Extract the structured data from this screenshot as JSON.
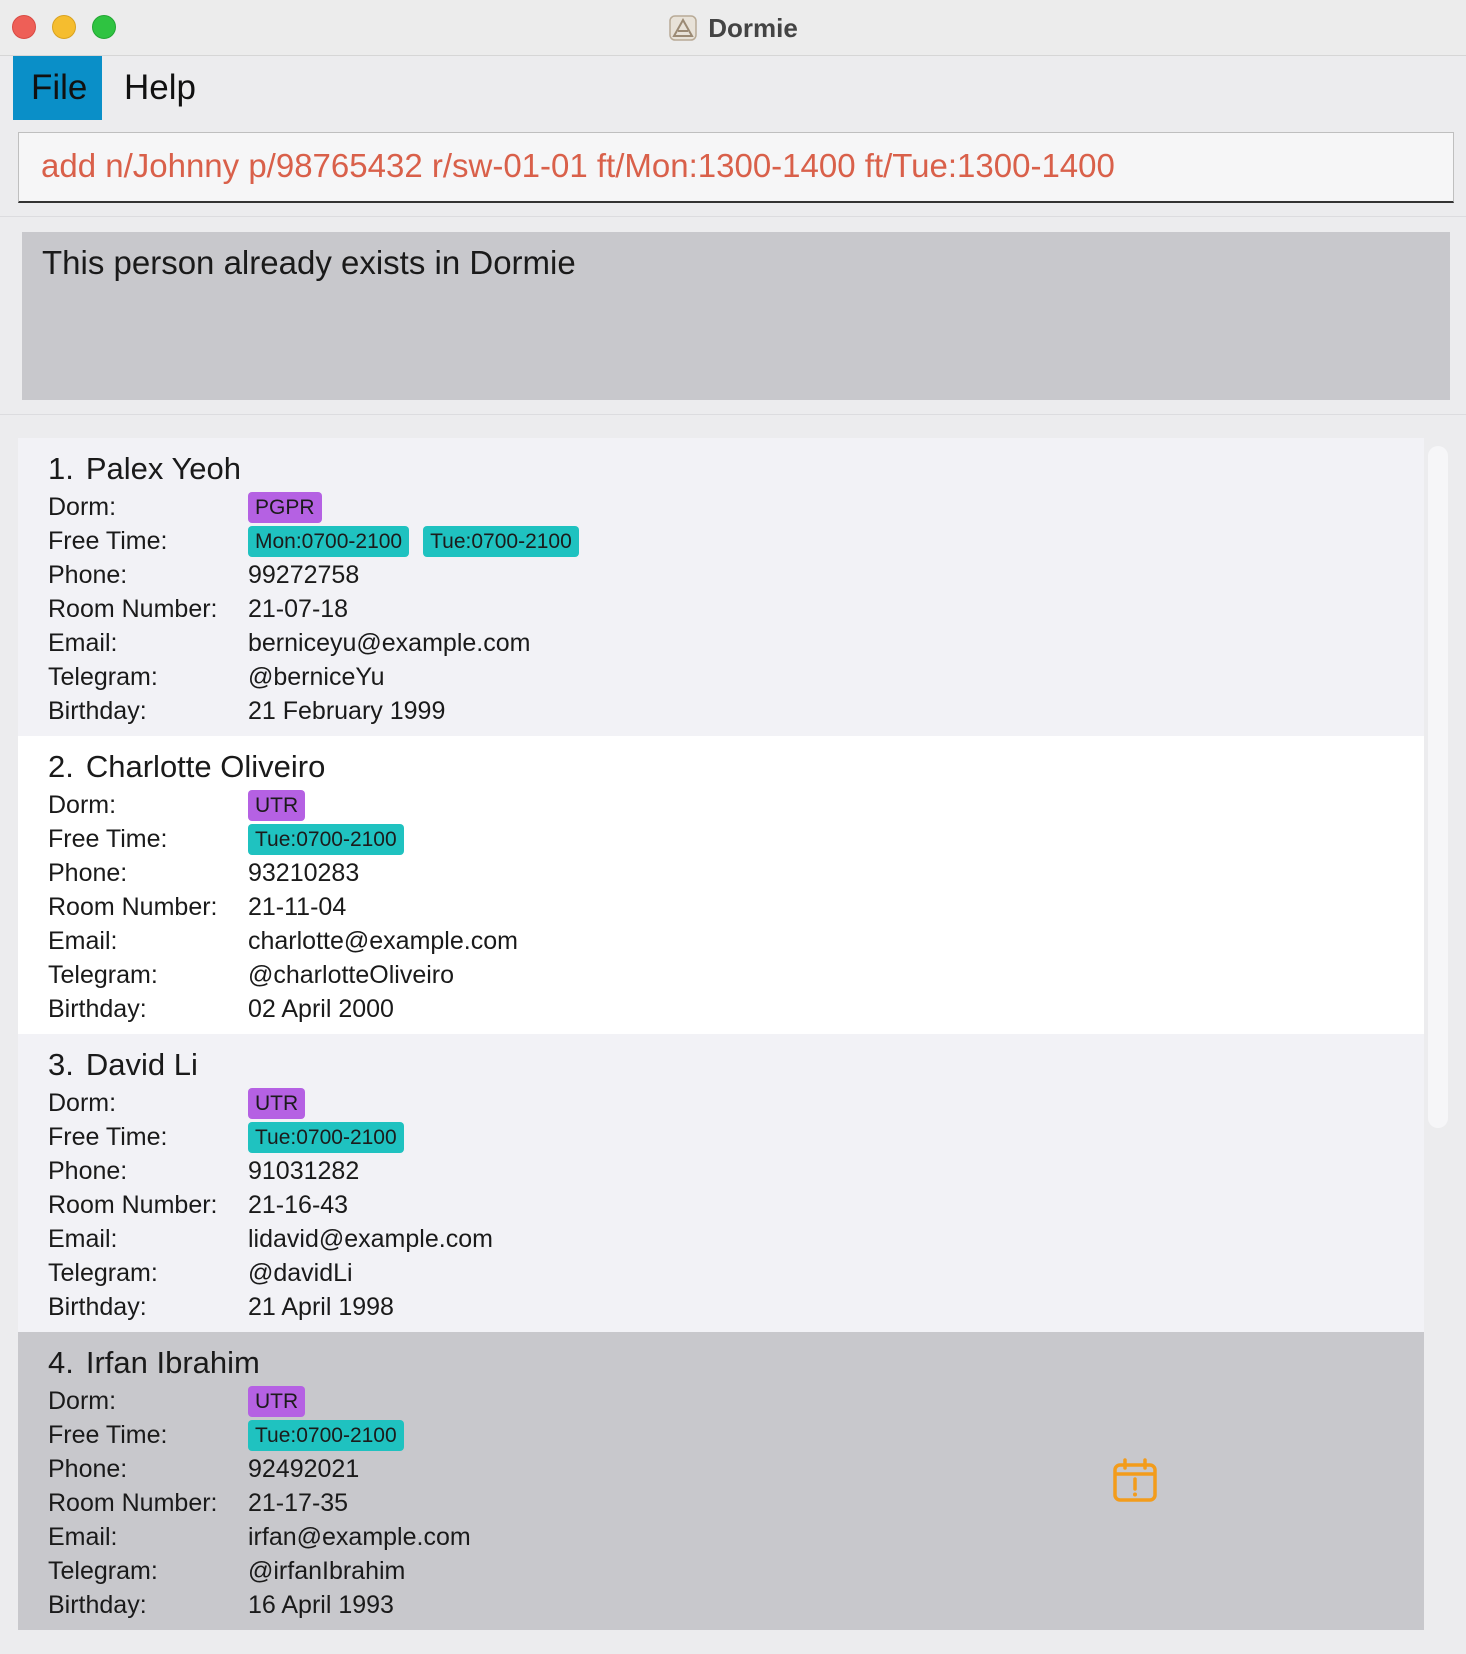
{
  "window": {
    "title": "Dormie"
  },
  "menu": {
    "file": "File",
    "help": "Help"
  },
  "command": {
    "value": "add n/Johnny p/98765432 r/sw-01-01 ft/Mon:1300-1400 ft/Tue:1300-1400"
  },
  "result": {
    "message": "This person already exists in Dormie"
  },
  "labels": {
    "dorm": "Dorm:",
    "free_time": "Free Time:",
    "phone": "Phone:",
    "room": "Room Number:",
    "email": "Email:",
    "telegram": "Telegram:",
    "birthday": "Birthday:"
  },
  "persons": [
    {
      "index": "1.",
      "name": "Palex Yeoh",
      "dorm": "PGPR",
      "free_times": [
        "Mon:0700-2100",
        "Tue:0700-2100"
      ],
      "phone": "99272758",
      "room": "21-07-18",
      "email": "berniceyu@example.com",
      "telegram": "@berniceYu",
      "birthday": "21 February 1999"
    },
    {
      "index": "2.",
      "name": "Charlotte Oliveiro",
      "dorm": "UTR",
      "free_times": [
        "Tue:0700-2100"
      ],
      "phone": "93210283",
      "room": "21-11-04",
      "email": "charlotte@example.com",
      "telegram": "@charlotteOliveiro",
      "birthday": "02 April 2000"
    },
    {
      "index": "3.",
      "name": "David Li",
      "dorm": "UTR",
      "free_times": [
        "Tue:0700-2100"
      ],
      "phone": "91031282",
      "room": "21-16-43",
      "email": "lidavid@example.com",
      "telegram": "@davidLi",
      "birthday": "21 April 1998"
    },
    {
      "index": "4.",
      "name": "Irfan Ibrahim",
      "dorm": "UTR",
      "free_times": [
        "Tue:0700-2100"
      ],
      "phone": "92492021",
      "room": "21-17-35",
      "email": "irfan@example.com",
      "telegram": "@irfanIbrahim",
      "birthday": "16 April 1993",
      "selected": true,
      "icon": "calendar-alert-icon"
    }
  ],
  "colors": {
    "menu_active": "#0a8fc8",
    "command_text": "#d9604a",
    "dorm_tag": "#b561e3",
    "free_time_tag": "#1fc2c0",
    "alert_icon": "#f39c1b"
  }
}
